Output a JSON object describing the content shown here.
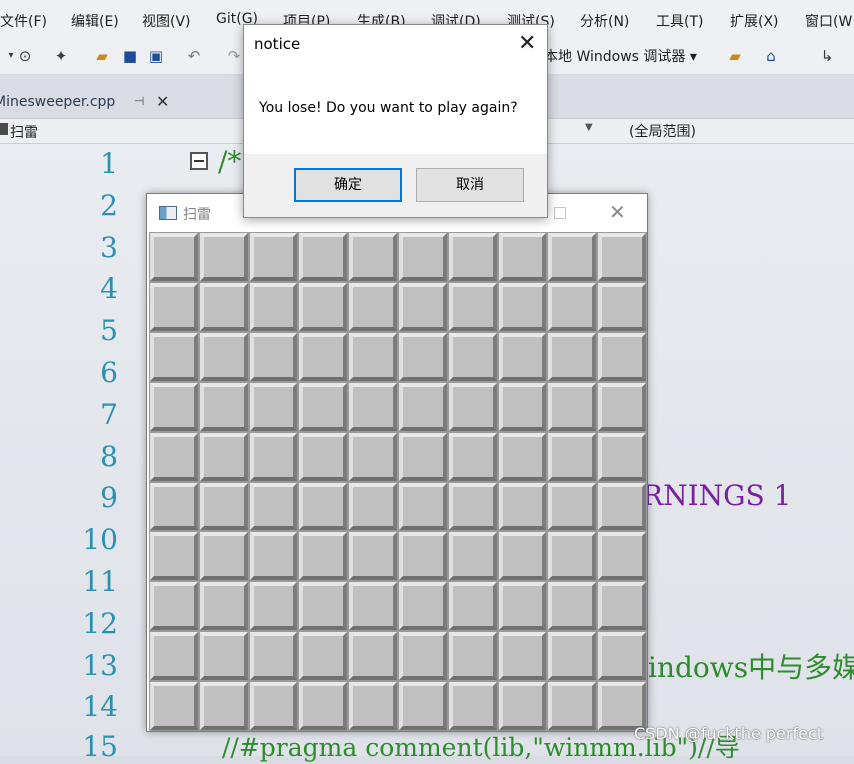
{
  "ide": {
    "menu": [
      "文件(F)",
      "编辑(E)",
      "视图(V)",
      "Git(G)",
      "项目(P)",
      "生成(B)",
      "调试(D)",
      "测试(S)",
      "分析(N)",
      "工具(T)",
      "扩展(X)",
      "窗口(W"
    ],
    "debugger_label": "本地 Windows 调试器",
    "file_tab": "Minesweeper.cpp",
    "nav_scope": "扫雷",
    "nav_global": "(全局范围)",
    "line_numbers": [
      "1",
      "2",
      "3",
      "4",
      "5",
      "6",
      "7",
      "8",
      "9",
      "10",
      "11",
      "12",
      "13",
      "14",
      "15"
    ],
    "code_fragments": {
      "line1": "/*",
      "line9": "RNINGS 1",
      "line13": "indows中与多媒",
      "line15": "//#pragma comment(lib,\"winmm.lib\")//导"
    },
    "watermark": "CSDN @fuckthe perfect"
  },
  "minesweeper": {
    "title": "扫雷",
    "rows": 10,
    "cols": 10
  },
  "dialog": {
    "title": "notice",
    "message": "You lose! Do you want to play again?",
    "ok_label": "确定",
    "cancel_label": "取消"
  },
  "colors": {
    "cell_face": "#c0c0c0",
    "primary_button_border": "#0078d7",
    "line_number": "#2b91af",
    "code_purple": "#7a1fa2",
    "code_green": "#2e8b2e"
  }
}
